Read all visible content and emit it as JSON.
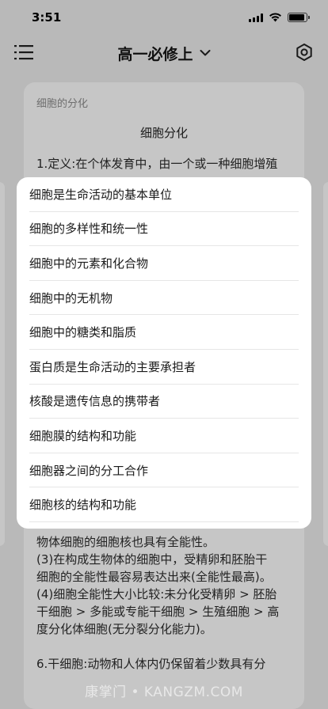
{
  "status_bar": {
    "time": "3:51"
  },
  "header": {
    "title": "高一必修上"
  },
  "article": {
    "breadcrumb": "细胞的分化",
    "heading": "细胞分化",
    "top_lines": [
      "1.定义:在个体发育中，由一个或一种细胞增殖"
    ],
    "bottom_lines": [
      "物体细胞的细胞核也具有全能性。",
      "(3)在构成生物体的细胞中，受精卵和胚胎干",
      "细胞的全能性最容易表达出来(全能性最高)。",
      "(4)细胞全能性大小比较:未分化受精卵 > 胚胎",
      "干细胞 > 多能或专能干细胞 > 生殖细胞 > 高",
      "度分化体细胞(无分裂分化能力)。"
    ],
    "last_line": "6.干细胞:动物和人体内仍保留着少数具有分"
  },
  "dropdown": {
    "items": [
      "细胞是生命活动的基本单位",
      "细胞的多样性和统一性",
      "细胞中的元素和化合物",
      "细胞中的无机物",
      "细胞中的糖类和脂质",
      "蛋白质是生命活动的主要承担者",
      "核酸是遗传信息的携带者",
      "细胞膜的结构和功能",
      "细胞器之间的分工合作",
      "细胞核的结构和功能"
    ]
  },
  "watermark": "康掌门 • KANGZM.COM",
  "icons": {
    "menu": "menu-icon",
    "settings": "settings-icon",
    "chevron": "chevron-down-icon",
    "wifi": "wifi-icon",
    "signal": "signal-icon",
    "battery": "battery-icon"
  },
  "colors": {
    "overlay": "#b9b9b9",
    "card": "#c6c6c6",
    "popup": "#ffffff"
  }
}
